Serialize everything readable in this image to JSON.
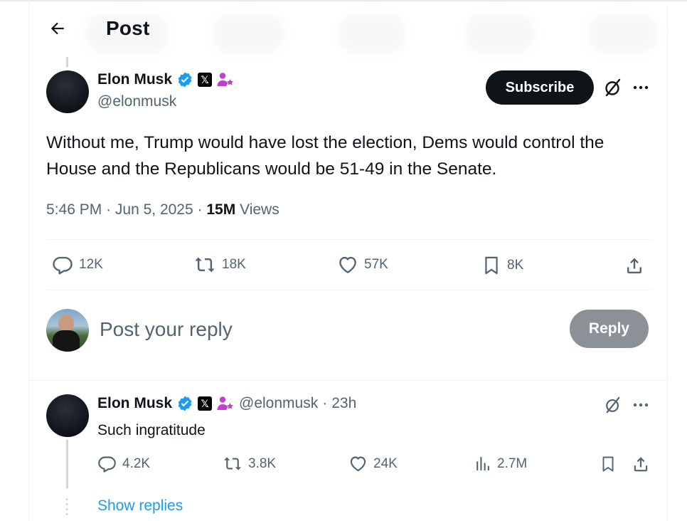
{
  "header": {
    "title": "Post"
  },
  "post": {
    "author_name": "Elon Musk",
    "author_handle": "@elonmusk",
    "subscribe_label": "Subscribe",
    "text": "Without me, Trump would have lost the election, Dems would control the House and the Republicans would be 51-49 in the Senate.",
    "time": "5:46 PM",
    "date": "Jun 5, 2025",
    "views_count": "15M",
    "views_label": "Views",
    "replies": "12K",
    "reposts": "18K",
    "likes": "57K",
    "bookmarks": "8K"
  },
  "compose": {
    "placeholder": "Post your reply",
    "reply_label": "Reply"
  },
  "reply": {
    "author_name": "Elon Musk",
    "author_handle": "@elonmusk",
    "age": "23h",
    "text": "Such ingratitude",
    "replies": "4.2K",
    "reposts": "3.8K",
    "likes": "24K",
    "views": "2.7M",
    "show_replies_label": "Show replies"
  },
  "badge_glyph": "𝕏",
  "separator": "·",
  "colors": {
    "accent": "#1d9bf0",
    "verified": "#1d9bf0",
    "affiliate_badge": "#c13ecf",
    "primary_text": "#0f1419",
    "secondary_text": "#536471",
    "disabled_button": "#8b9196"
  },
  "icons": [
    "back-arrow-icon",
    "verified-badge-icon",
    "x-badge-icon",
    "affiliate-badge-icon",
    "grok-icon",
    "more-icon",
    "reply-icon",
    "repost-icon",
    "like-icon",
    "bookmark-icon",
    "share-icon",
    "views-icon"
  ]
}
